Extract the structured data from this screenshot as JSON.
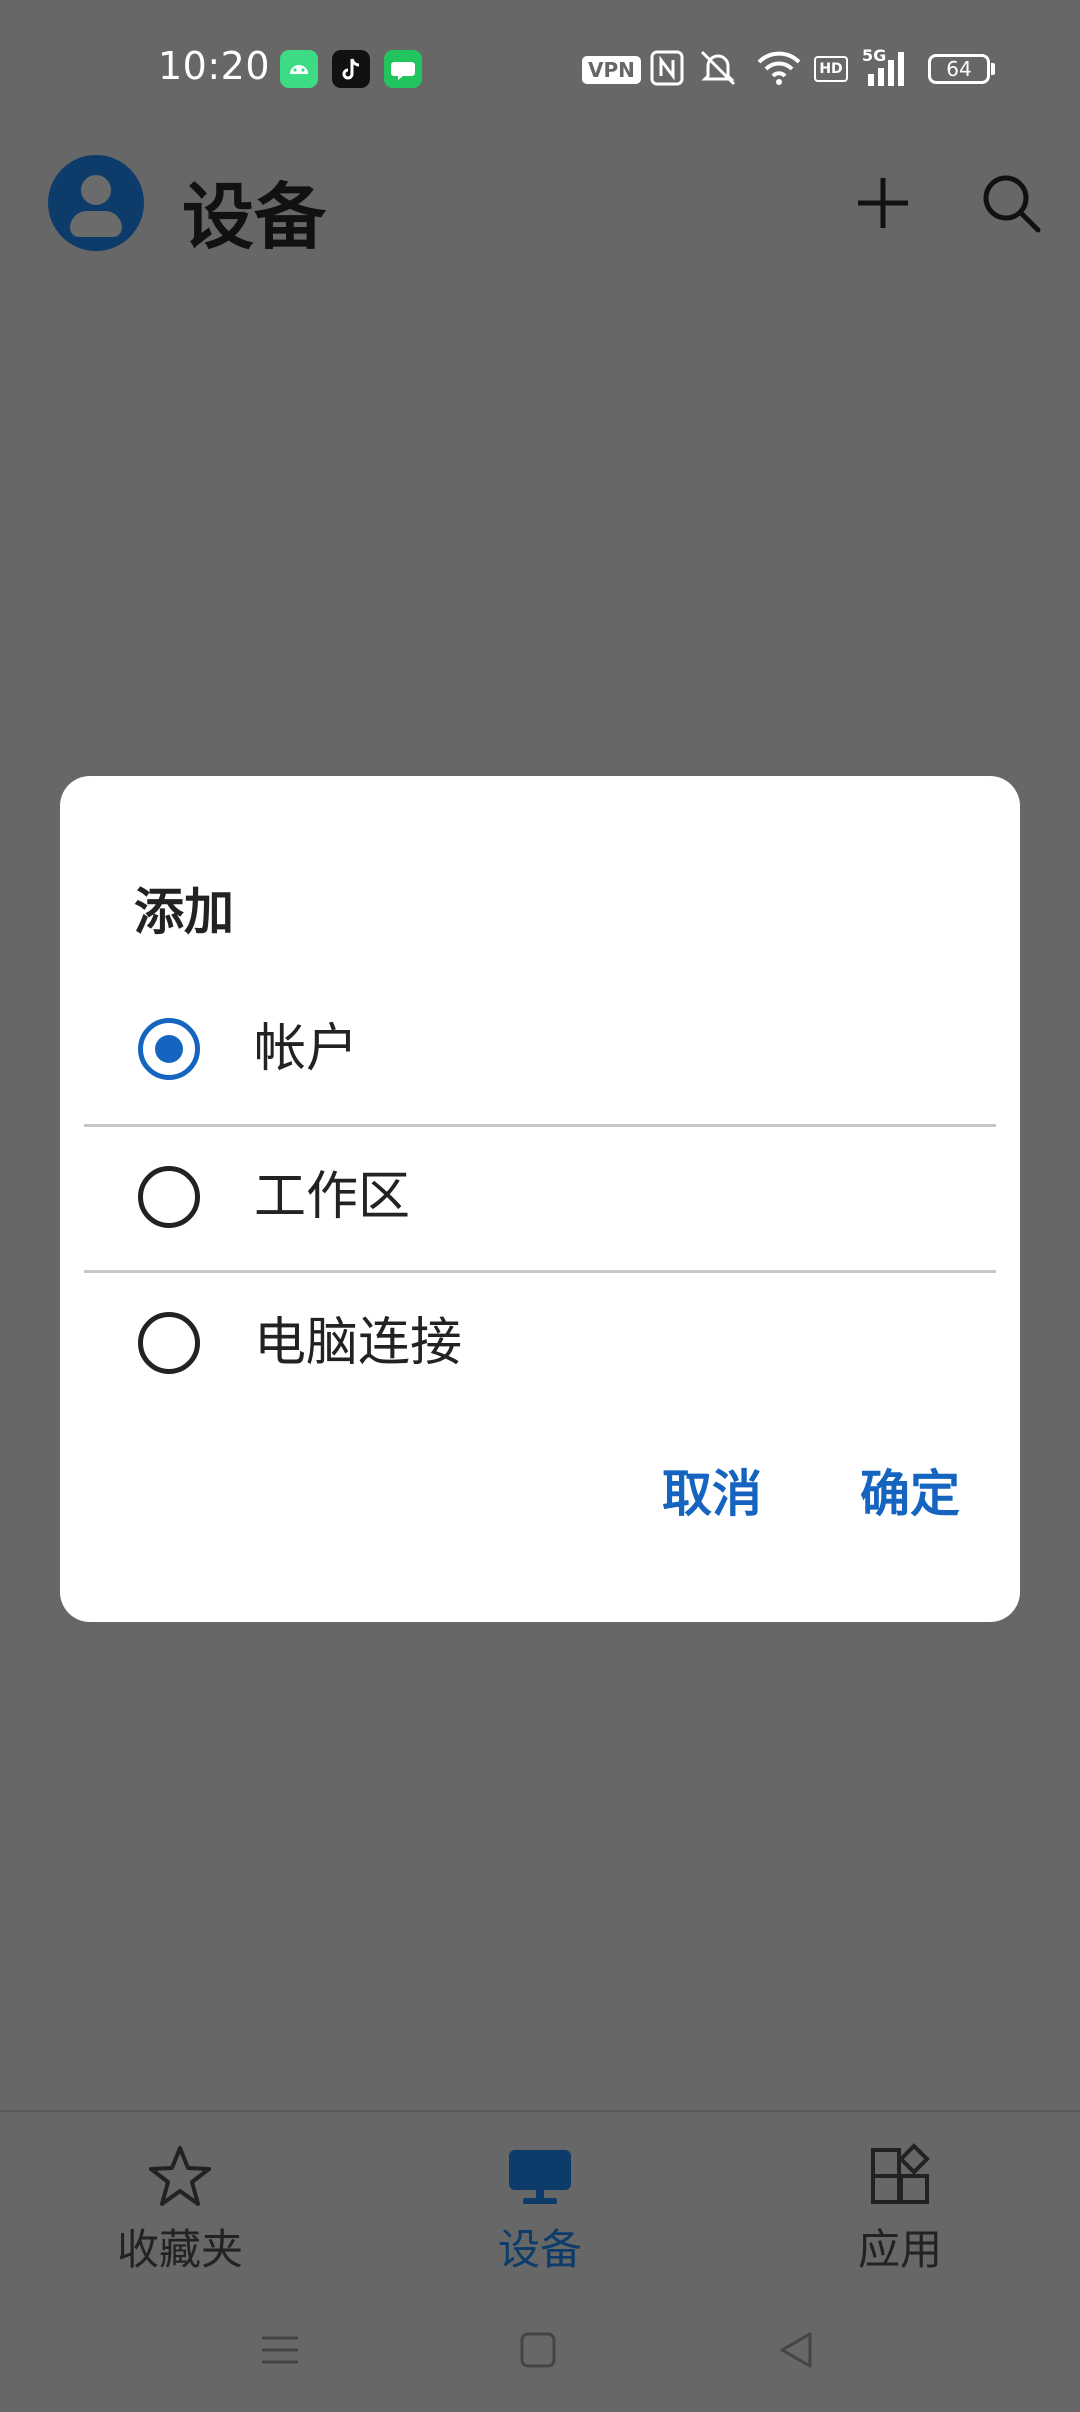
{
  "status_bar": {
    "time": "10:20",
    "vpn_label": "VPN",
    "hd_label": "HD",
    "network_label": "5G",
    "battery_level": "64",
    "notification_icons": [
      "android-icon",
      "tiktok-icon",
      "chat-app-icon"
    ]
  },
  "header": {
    "title": "设备",
    "avatar_icon": "user-avatar-icon",
    "add_icon": "plus-icon",
    "search_icon": "search-icon"
  },
  "dialog": {
    "title": "添加",
    "options": [
      {
        "label": "帐户",
        "selected": true
      },
      {
        "label": "工作区",
        "selected": false
      },
      {
        "label": "电脑连接",
        "selected": false
      }
    ],
    "cancel_label": "取消",
    "confirm_label": "确定"
  },
  "bottom_nav": {
    "items": [
      {
        "label": "收藏夹",
        "icon": "star-icon",
        "active": false
      },
      {
        "label": "设备",
        "icon": "monitor-icon",
        "active": true
      },
      {
        "label": "应用",
        "icon": "apps-icon",
        "active": false
      }
    ]
  },
  "colors": {
    "scrim_background": "#676767",
    "accent": "#1565c0",
    "active_nav": "#0d3c6b",
    "dialog_background": "#ffffff"
  }
}
